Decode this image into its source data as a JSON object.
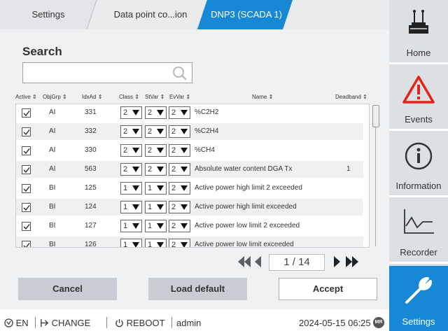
{
  "tabs": {
    "settings": "Settings",
    "data_point": "Data point co...ion",
    "dnp3": "DNP3 (SCADA 1)"
  },
  "search": {
    "title": "Search",
    "placeholder": "",
    "value": ""
  },
  "columns": {
    "active": "Active",
    "objgrp": "ObjGrp",
    "idxad": "IdxAd",
    "class": "Class",
    "stvar": "StVar",
    "evvar": "EvVar",
    "name": "Name",
    "deadband": "Deadband"
  },
  "rows": [
    {
      "active": true,
      "objgrp": "AI",
      "idxad": "331",
      "class": "2",
      "stvar": "2",
      "evvar": "2",
      "name": "%C2H2",
      "deadband": ""
    },
    {
      "active": true,
      "objgrp": "AI",
      "idxad": "332",
      "class": "2",
      "stvar": "2",
      "evvar": "2",
      "name": "%C2H4",
      "deadband": ""
    },
    {
      "active": true,
      "objgrp": "AI",
      "idxad": "330",
      "class": "2",
      "stvar": "2",
      "evvar": "2",
      "name": "%CH4",
      "deadband": ""
    },
    {
      "active": true,
      "objgrp": "AI",
      "idxad": "563",
      "class": "2",
      "stvar": "2",
      "evvar": "2",
      "name": "Absolute water content DGA Tx",
      "deadband": "1"
    },
    {
      "active": true,
      "objgrp": "BI",
      "idxad": "125",
      "class": "1",
      "stvar": "1",
      "evvar": "2",
      "name": "Active power high limit 2 exceeded",
      "deadband": ""
    },
    {
      "active": true,
      "objgrp": "BI",
      "idxad": "124",
      "class": "1",
      "stvar": "1",
      "evvar": "2",
      "name": "Active power high limit exceeded",
      "deadband": ""
    },
    {
      "active": true,
      "objgrp": "BI",
      "idxad": "127",
      "class": "1",
      "stvar": "1",
      "evvar": "2",
      "name": "Active power low limit 2 exceeded",
      "deadband": ""
    },
    {
      "active": true,
      "objgrp": "BI",
      "idxad": "126",
      "class": "1",
      "stvar": "1",
      "evvar": "2",
      "name": "Active power low limit exceeded",
      "deadband": ""
    }
  ],
  "pagination": {
    "page": "1 / 14"
  },
  "buttons": {
    "cancel": "Cancel",
    "load_default": "Load default",
    "accept": "Accept"
  },
  "footer": {
    "language": "EN",
    "change": "CHANGE",
    "reboot": "REBOOT",
    "user": "admin",
    "datetime": "2024-05-15 06:25",
    "badge": "MR"
  },
  "sidebar": {
    "home": "Home",
    "events": "Events",
    "information": "Information",
    "recorder": "Recorder",
    "settings": "Settings"
  },
  "colors": {
    "accent": "#1788d5",
    "alert": "#e2231a"
  }
}
